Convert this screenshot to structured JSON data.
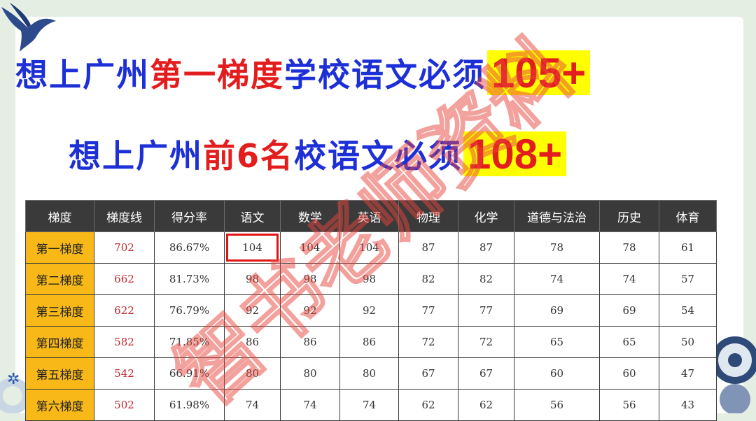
{
  "headline1": {
    "prefix": "想上广州",
    "emphasis": "第一梯度",
    "suffix": "学校语文必须",
    "score": "105+"
  },
  "headline2": {
    "prefix": "想上广州",
    "emphasis": "前6名",
    "suffix": "校语文必须",
    "score": "108+"
  },
  "watermark": "智书老师资料",
  "colors": {
    "headline_blue": "#1d2fd6",
    "headline_red": "#e31d1d",
    "highlight_yellow": "#ffff00",
    "header_dark": "#3a3a3a",
    "tier_orange": "#f7b818",
    "score_line_red": "#c0272d",
    "box_red": "#e01515"
  },
  "icons": [
    "swallow-bird-icon",
    "flower-decoration-icon",
    "star-icon"
  ],
  "table": {
    "headers": [
      "梯度",
      "梯度线",
      "得分率",
      "语文",
      "数学",
      "英语",
      "物理",
      "化学",
      "道德与法治",
      "历史",
      "体育"
    ],
    "rows": [
      [
        "第一梯度",
        "702",
        "86.67%",
        "104",
        "104",
        "104",
        "87",
        "87",
        "78",
        "78",
        "61"
      ],
      [
        "第二梯度",
        "662",
        "81.73%",
        "98",
        "98",
        "98",
        "82",
        "82",
        "74",
        "74",
        "57"
      ],
      [
        "第三梯度",
        "622",
        "76.79%",
        "92",
        "92",
        "92",
        "77",
        "77",
        "69",
        "69",
        "54"
      ],
      [
        "第四梯度",
        "582",
        "71.85%",
        "86",
        "86",
        "86",
        "72",
        "72",
        "65",
        "65",
        "50"
      ],
      [
        "第五梯度",
        "542",
        "66.91%",
        "80",
        "80",
        "80",
        "67",
        "67",
        "60",
        "60",
        "47"
      ],
      [
        "第六梯度",
        "502",
        "61.98%",
        "74",
        "74",
        "74",
        "62",
        "62",
        "56",
        "56",
        "43"
      ]
    ],
    "highlighted_cell": "第一梯度 语文 104"
  }
}
